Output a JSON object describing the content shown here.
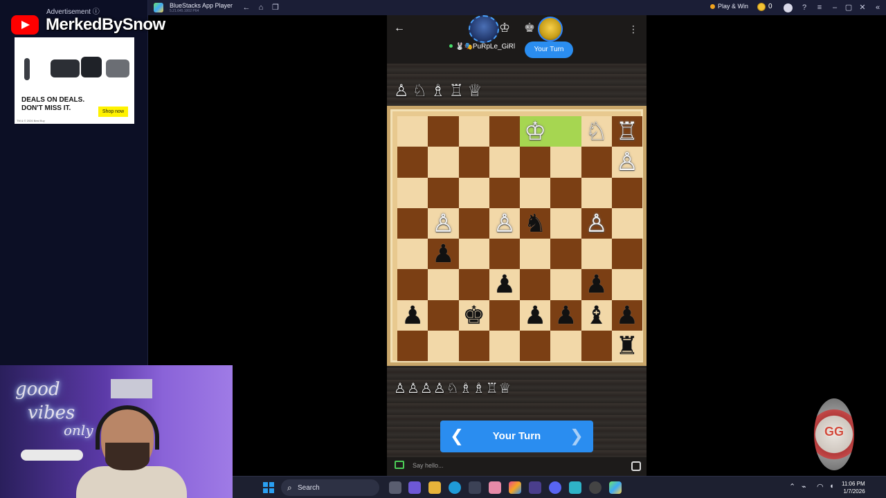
{
  "window": {
    "title": "BlueStacks App Player",
    "subtitle": "5.21.645.1002  P64",
    "play_win": "Play & Win",
    "coins": "0"
  },
  "left_panel": {
    "ad_label": "Advertisement ⓘ",
    "channel_name": "MerkedBySnow",
    "ad_headline": "DEALS ON DEALS. DON'T MISS IT.",
    "ad_cta": "Shop now",
    "ad_fine": "TM & © 2026 Best Buy"
  },
  "game": {
    "opponent_name": "🐰🎭PuRpLe_GiRl",
    "turn_pill": "Your Turn",
    "turn_button": "Your Turn",
    "chat_placeholder": "Say hello...",
    "captured_top": [
      "♙",
      "♘",
      "♗",
      "♖",
      "♕"
    ],
    "captured_bottom": [
      "♙",
      "♙",
      "♙",
      "♙",
      "♘",
      "♗",
      "♗",
      "♖",
      "♕"
    ],
    "board": [
      [
        "",
        "",
        "",
        "",
        "W♔",
        "",
        "W♘",
        "W♖"
      ],
      [
        "",
        "",
        "",
        "",
        "",
        "",
        "",
        "W♙"
      ],
      [
        "",
        "",
        "",
        "",
        "",
        "",
        "",
        ""
      ],
      [
        "",
        "W♙",
        "",
        "W♙",
        "B♞",
        "",
        "W♙",
        ""
      ],
      [
        "",
        "B♟",
        "",
        "",
        "",
        "",
        "",
        ""
      ],
      [
        "",
        "",
        "",
        "B♟",
        "",
        "",
        "B♟",
        ""
      ],
      [
        "B♟",
        "",
        "B♚",
        "",
        "B♟",
        "B♟",
        "B♝",
        "B♟"
      ],
      [
        "",
        "",
        "",
        "",
        "",
        "",
        "",
        "B♜"
      ]
    ],
    "highlight": [
      [
        0,
        4
      ],
      [
        0,
        5
      ]
    ]
  },
  "webcam": {
    "neon_line1": "good",
    "neon_line2": "vibes",
    "neon_line3": "only"
  },
  "chip": {
    "label": "GG"
  },
  "taskbar": {
    "search_label": "Search",
    "time": "11:06 PM",
    "date": "1/7/2026"
  },
  "colors": {
    "accent": "#2a8df0",
    "light_square": "#f2d8a8",
    "dark_square": "#7b3f14",
    "highlight": "#a6d651"
  }
}
